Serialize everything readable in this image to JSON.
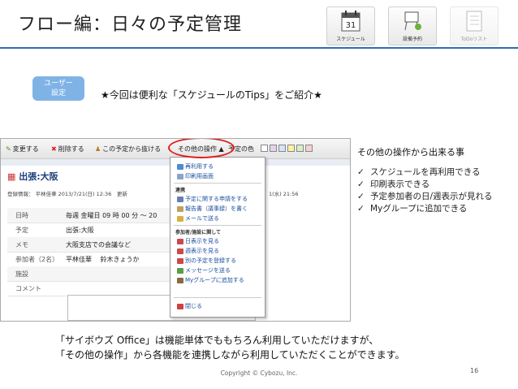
{
  "slide": {
    "title": "フロー編：日々の予定管理",
    "badge": "ユーザー\n設定",
    "intro": "★今回は便利な「スケジュールのTips」をご紹介★",
    "page_number": "16",
    "copyright": "Copyright © Cybozu, Inc."
  },
  "apps": [
    {
      "label": "スケジュール",
      "icon": "calendar-icon",
      "day": "31"
    },
    {
      "label": "設備予約",
      "icon": "facility-icon"
    },
    {
      "label": "ToDoリスト",
      "icon": "todo-icon"
    }
  ],
  "screenshot": {
    "toolbar": {
      "change": "変更する",
      "delete": "削除する",
      "leave": "この予定から抜ける",
      "other_ops": "その他の操作 ▲",
      "color": "予定の色"
    },
    "event_title": "出張:大阪",
    "meta_left": "登録情報： 平林佳華 2013/7/21(日) 12:36　更新",
    "meta_right": "1(水) 21:56",
    "rows": [
      {
        "k": "日時",
        "v": "毎週 金曜日 09 時 00 分 ～ 20"
      },
      {
        "k": "予定",
        "v": "出張:大阪"
      },
      {
        "k": "メモ",
        "v": "大阪支店での会議など"
      },
      {
        "k": "参加者（2名）",
        "v": "平林佳華 　鈴木きょうか"
      },
      {
        "k": "施設",
        "v": ""
      },
      {
        "k": "コメント",
        "v": ""
      }
    ],
    "menu": {
      "items_top": [
        "再利用する",
        "印刷用画面"
      ],
      "sec_link": "連携",
      "items_link": [
        "予定に関する申請をする",
        "報告書（議事録）を書く",
        "メールで送る"
      ],
      "sec_member": "参加者/施設に関して",
      "items_member": [
        "日表示を見る",
        "週表示を見る",
        "別の予定を登録する",
        "メッセージを送る",
        "Myグループに追加する"
      ],
      "close": "閉じる"
    }
  },
  "side": {
    "heading": "その他の操作から出来る事",
    "items": [
      "スケジュールを再利用できる",
      "印刷表示できる",
      "予定参加者の日/週表示が見れる",
      "Myグループに追加できる"
    ]
  },
  "footer": {
    "line1": "「サイボウズ Office」は機能単体でももちろん利用していただけますが、",
    "line2": "「その他の操作」から各機能を連携しながら利用していただくことができます。"
  },
  "colors": {
    "accent": "#2d6db5",
    "badge": "#7fb3e6",
    "highlight": "#e02020"
  }
}
